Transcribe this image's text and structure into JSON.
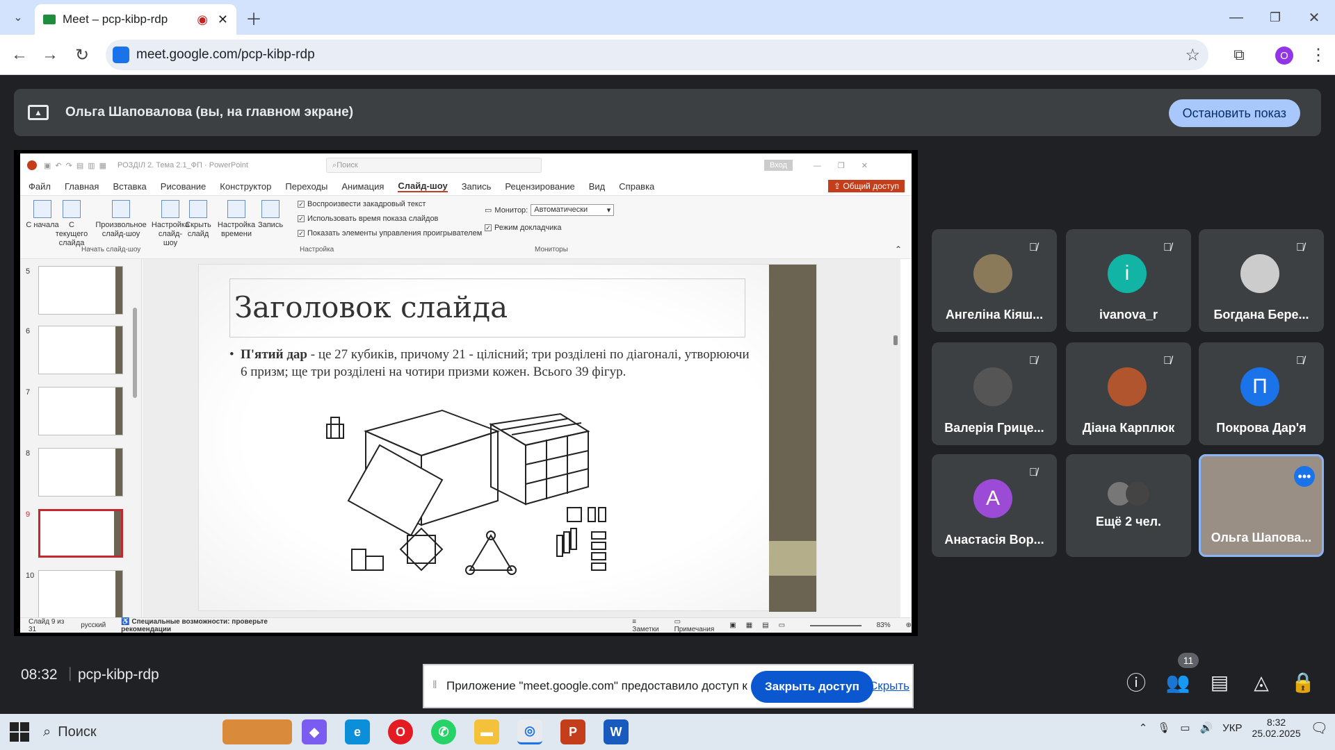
{
  "browser": {
    "tab_title": "Meet – pcp-kibp-rdp",
    "url": "meet.google.com/pcp-kibp-rdp",
    "profile_initial": "O"
  },
  "meet": {
    "presenting_banner": "Ольга Шаповалова (вы, на главном экране)",
    "stop_button": "Остановить показ",
    "clock": "08:32",
    "meeting_code": "pcp-kibp-rdp",
    "participants_count": "11",
    "participants": [
      {
        "name": "Ангеліна Кіяш...",
        "initial": "",
        "color": "#8a7a5a",
        "muted": true
      },
      {
        "name": "ivanova_r",
        "initial": "i",
        "color": "#12b5a5",
        "muted": true
      },
      {
        "name": "Богдана Бере...",
        "initial": "",
        "color": "#cccccc",
        "muted": true
      },
      {
        "name": "Валерія Грице...",
        "initial": "",
        "color": "#555555",
        "muted": true
      },
      {
        "name": "Діана Карплюк",
        "initial": "",
        "color": "#b0552e",
        "muted": true
      },
      {
        "name": "Покрова Дар'я",
        "initial": "П",
        "color": "#1a73e8",
        "muted": true
      },
      {
        "name": "Анастасія Вор...",
        "initial": "A",
        "color": "#9c4bd6",
        "muted": true
      },
      {
        "name": "Ещё 2 чел.",
        "initial": "",
        "color": "#777777",
        "muted": false
      },
      {
        "name": "Ольга Шапова...",
        "initial": "",
        "color": "#9a8f85",
        "muted": false
      }
    ],
    "notify_text": "Приложение \"meet.google.com\" предоставило доступ к окну.",
    "close_access": "Закрыть доступ",
    "hide": "Скрыть"
  },
  "ppt": {
    "window_title": "РОЗДІЛ 2. Тема 2.1_ФП  ·  PowerPoint",
    "search_placeholder": "Поиск",
    "login": "Вход",
    "share": "Общий доступ",
    "menu": [
      "Файл",
      "Главная",
      "Вставка",
      "Рисование",
      "Конструктор",
      "Переходы",
      "Анимация",
      "Слайд-шоу",
      "Запись",
      "Рецензирование",
      "Вид",
      "Справка"
    ],
    "ribbon": {
      "btn_from_start": "С начала",
      "btn_from_current": "С текущего слайда",
      "btn_custom": "Произвольное слайд-шоу",
      "btn_setup": "Настройка слайд-шоу",
      "btn_hide": "Скрыть слайд",
      "btn_timing": "Настройка времени",
      "btn_record": "Запись",
      "chk1": "Воспроизвести закадровый текст",
      "chk2": "Использовать время показа слайдов",
      "chk3": "Показать элементы управления проигрывателем",
      "monitor_label": "Монитор:",
      "monitor_value": "Автоматически",
      "presenter_view": "Режим докладчика",
      "grp_start": "Начать слайд-шоу",
      "grp_setup": "Настройка",
      "grp_monitors": "Мониторы"
    },
    "thumbs": [
      "5",
      "6",
      "7",
      "8",
      "9",
      "10"
    ],
    "slide": {
      "title": "Заголовок слайда",
      "bold_part": "П'ятий дар",
      "body": " - це 27 кубиків, причому 21 - цілісний; три розділені по діагоналі, утворюючи 6 призм; ще три розділені на чотири призми кожен. Всього 39 фігур."
    },
    "status": {
      "slide_of": "Слайд 9 из 31",
      "lang": "русский",
      "accessibility": "Специальные возможности: проверьте рекомендации",
      "notes": "Заметки",
      "comments": "Примечания",
      "zoom": "83%"
    }
  },
  "taskbar": {
    "search": "Поиск",
    "lang": "УКР",
    "time": "8:32",
    "date": "25.02.2025"
  }
}
